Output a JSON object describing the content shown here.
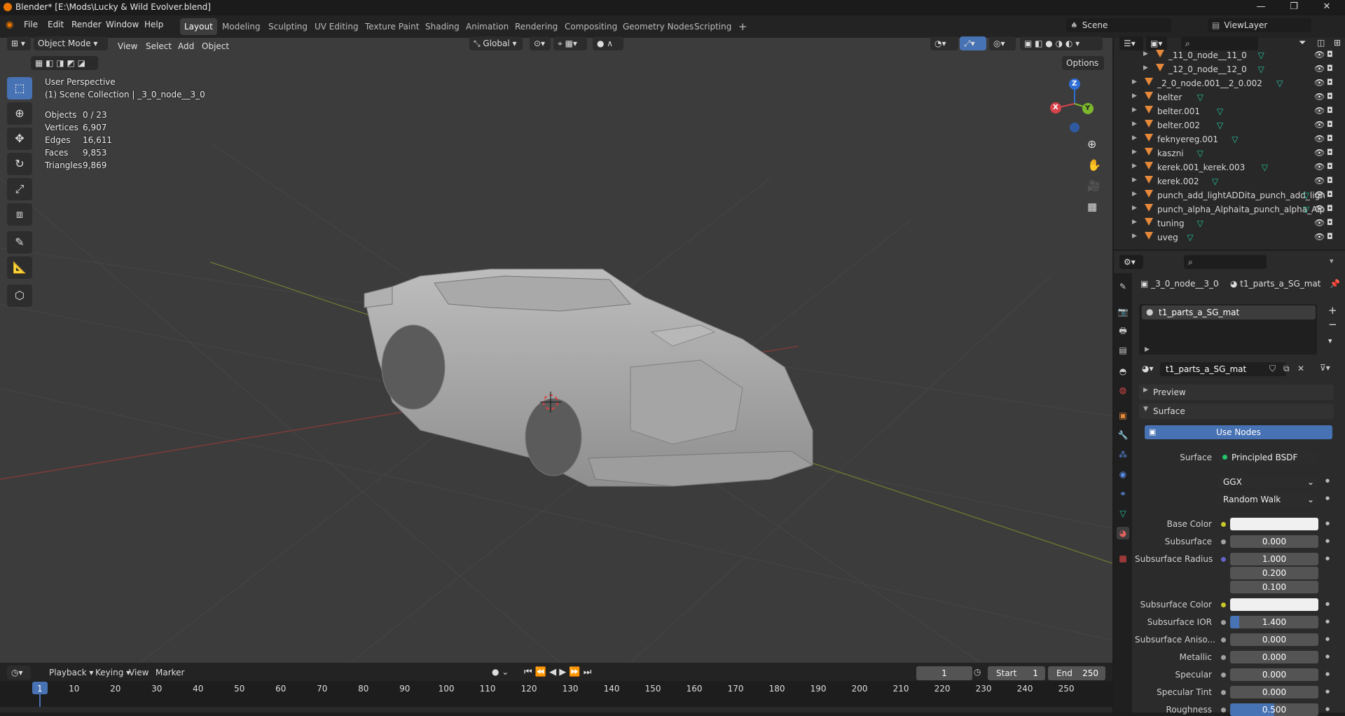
{
  "window": {
    "title": "Blender* [E:\\Mods\\Lucky & Wild Evolver.blend]",
    "minimize": "—",
    "maximize": "❐",
    "close": "✕"
  },
  "menus": [
    "File",
    "Edit",
    "Render",
    "Window",
    "Help"
  ],
  "workspaces": [
    "Layout",
    "Modeling",
    "Sculpting",
    "UV Editing",
    "Texture Paint",
    "Shading",
    "Animation",
    "Rendering",
    "Compositing",
    "Geometry Nodes",
    "Scripting"
  ],
  "workspace_add": "+",
  "scene": {
    "name": "Scene",
    "view_layer": "ViewLayer"
  },
  "viewport_header": {
    "mode": "Object Mode",
    "menus": [
      "View",
      "Select",
      "Add",
      "Object"
    ],
    "orientation": "Global",
    "options": "Options"
  },
  "overlay": {
    "perspective": "User Perspective",
    "collection": "(1) Scene Collection | _3_0_node__3_0"
  },
  "stats": [
    {
      "label": "Objects",
      "value": "0 / 23"
    },
    {
      "label": "Vertices",
      "value": "6,907"
    },
    {
      "label": "Edges",
      "value": "16,611"
    },
    {
      "label": "Faces",
      "value": "9,853"
    },
    {
      "label": "Triangles",
      "value": "9,869"
    }
  ],
  "gizmo": {
    "x": "X",
    "y": "Y",
    "z": "Z"
  },
  "outliner": {
    "items": [
      {
        "name": "_11_0_node__11_0",
        "indent": 2
      },
      {
        "name": "_12_0_node__12_0",
        "indent": 2
      },
      {
        "name": "_2_0_node.001__2_0.002",
        "indent": 1
      },
      {
        "name": "belter",
        "indent": 1
      },
      {
        "name": "belter.001",
        "indent": 1
      },
      {
        "name": "belter.002",
        "indent": 1
      },
      {
        "name": "feknyereg.001",
        "indent": 1
      },
      {
        "name": "kaszni",
        "indent": 1
      },
      {
        "name": "kerek.001_kerek.003",
        "indent": 1
      },
      {
        "name": "kerek.002",
        "indent": 1
      },
      {
        "name": "punch_add_lightADDita_punch_add_ligh",
        "indent": 1
      },
      {
        "name": "punch_alpha_Alphaita_punch_alpha_Alp",
        "indent": 1
      },
      {
        "name": "tuning",
        "indent": 1
      },
      {
        "name": "uveg",
        "indent": 1
      }
    ]
  },
  "properties": {
    "breadcrumb_object": "_3_0_node__3_0",
    "breadcrumb_material": "t1_parts_a_SG_mat",
    "slot": "t1_parts_a_SG_mat",
    "material_name": "t1_parts_a_SG_mat",
    "panels": {
      "preview": "Preview",
      "surface": "Surface"
    },
    "use_nodes": "Use Nodes",
    "surface_label": "Surface",
    "surface_shader": "Principled BSDF",
    "distribution": "GGX",
    "subsurface_method": "Random Walk",
    "fields": [
      {
        "label": "Base Color",
        "value": "",
        "type": "color"
      },
      {
        "label": "Subsurface",
        "value": "0.000"
      },
      {
        "label": "Subsurface Radius",
        "value": "1.000"
      },
      {
        "label": "",
        "value": "0.200"
      },
      {
        "label": "",
        "value": "0.100"
      },
      {
        "label": "Subsurface Color",
        "value": "",
        "type": "color"
      },
      {
        "label": "Subsurface IOR",
        "value": "1.400",
        "fill": 0.1
      },
      {
        "label": "Subsurface Aniso...",
        "value": "0.000"
      },
      {
        "label": "Metallic",
        "value": "0.000"
      },
      {
        "label": "Specular",
        "value": "0.000"
      },
      {
        "label": "Specular Tint",
        "value": "0.000"
      },
      {
        "label": "Roughness",
        "value": "0.500",
        "fill": 0.5
      }
    ]
  },
  "timeline": {
    "menus": [
      "Playback",
      "Keying",
      "View",
      "Marker"
    ],
    "current_frame": "1",
    "start_label": "Start",
    "start": "1",
    "end_label": "End",
    "end": "250",
    "ticks": [
      "1",
      "10",
      "20",
      "30",
      "40",
      "50",
      "60",
      "70",
      "80",
      "90",
      "100",
      "110",
      "120",
      "130",
      "140",
      "150",
      "160",
      "170",
      "180",
      "190",
      "200",
      "210",
      "220",
      "230",
      "240",
      "250"
    ]
  },
  "colors": {
    "accent": "#4772b3",
    "object_icon": "#e5883a",
    "modifier_icon": "#22c7a0"
  }
}
